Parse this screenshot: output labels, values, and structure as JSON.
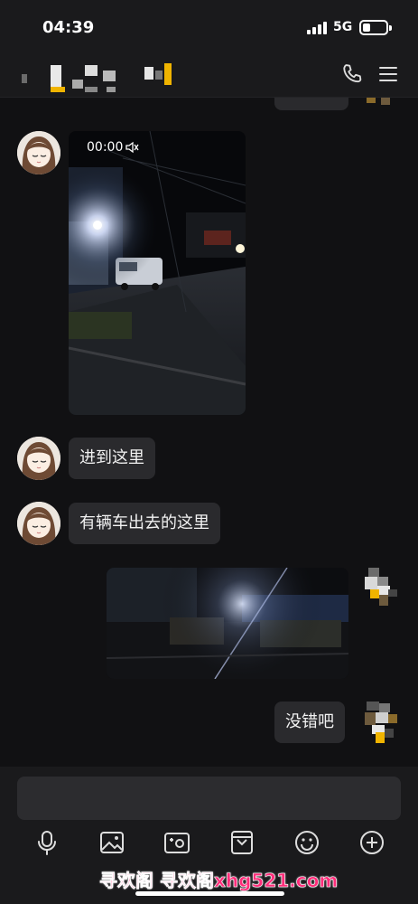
{
  "status_bar": {
    "time": "04:39",
    "network": "5G"
  },
  "header": {
    "call_icon": "phone-icon",
    "menu_icon": "menu-icon"
  },
  "messages": [
    {
      "side": "left",
      "type": "video",
      "duration": "00:00",
      "muted": true
    },
    {
      "side": "left",
      "type": "text",
      "text": "进到这里"
    },
    {
      "side": "left",
      "type": "text",
      "text": "有辆车出去的这里"
    },
    {
      "side": "right",
      "type": "image"
    },
    {
      "side": "right",
      "type": "text",
      "text": "没错吧"
    }
  ],
  "toolbar": [
    "mic-icon",
    "image-icon",
    "camera-icon",
    "file-icon",
    "emoji-icon",
    "plus-icon"
  ],
  "watermark": "寻欢阁 寻欢阁xhg521.com",
  "colors": {
    "background": "#111113",
    "bubble": "#2a2a2d",
    "bar": "#1a1a1c",
    "watermark": "#ff2d7a"
  }
}
